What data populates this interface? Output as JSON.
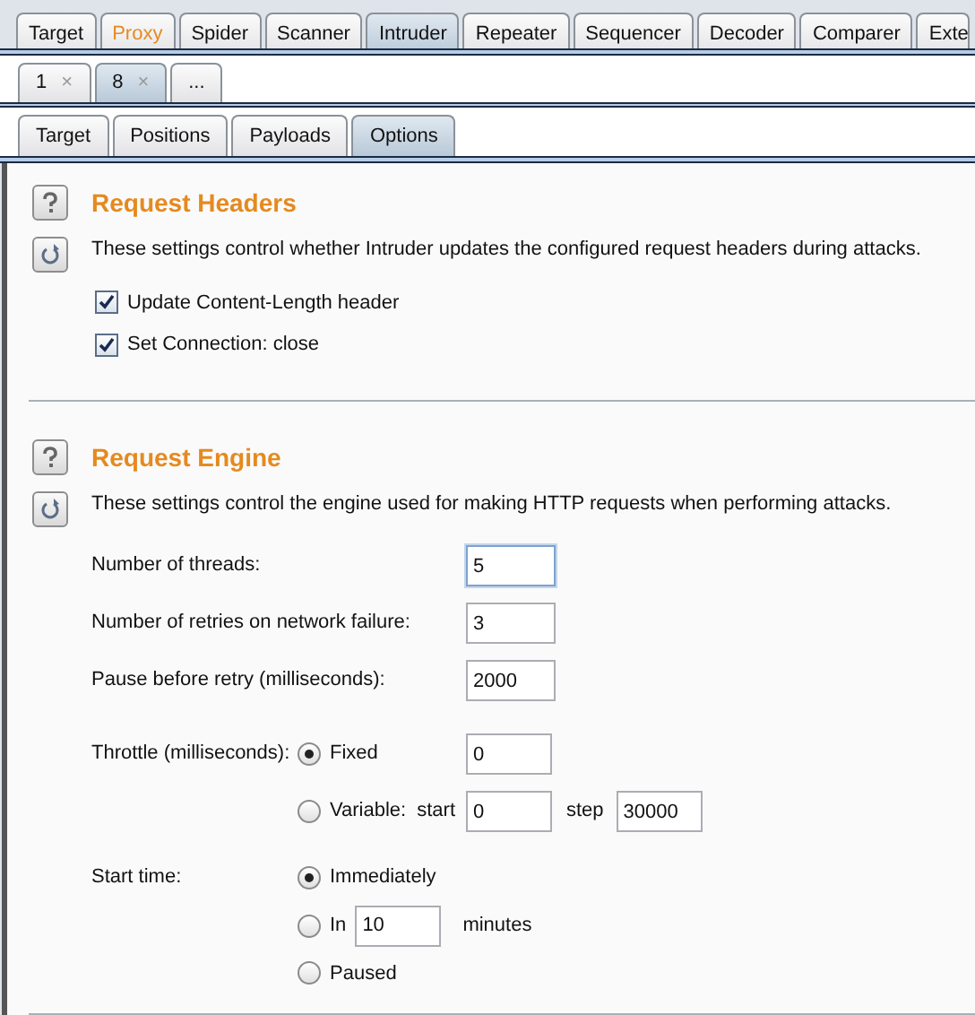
{
  "main_tabs": [
    {
      "label": "Target",
      "selected": false,
      "highlighted": false
    },
    {
      "label": "Proxy",
      "selected": false,
      "highlighted": true
    },
    {
      "label": "Spider",
      "selected": false,
      "highlighted": false
    },
    {
      "label": "Scanner",
      "selected": false,
      "highlighted": false
    },
    {
      "label": "Intruder",
      "selected": true,
      "highlighted": false
    },
    {
      "label": "Repeater",
      "selected": false,
      "highlighted": false
    },
    {
      "label": "Sequencer",
      "selected": false,
      "highlighted": false
    },
    {
      "label": "Decoder",
      "selected": false,
      "highlighted": false
    },
    {
      "label": "Comparer",
      "selected": false,
      "highlighted": false
    },
    {
      "label": "Exte",
      "selected": false,
      "highlighted": false
    }
  ],
  "attack_tabs": [
    {
      "label": "1",
      "close": "×",
      "selected": false
    },
    {
      "label": "8",
      "close": "×",
      "selected": true
    },
    {
      "label": "...",
      "selected": false
    }
  ],
  "sub_tabs": [
    {
      "label": "Target",
      "selected": false
    },
    {
      "label": "Positions",
      "selected": false
    },
    {
      "label": "Payloads",
      "selected": false
    },
    {
      "label": "Options",
      "selected": true
    }
  ],
  "request_headers": {
    "title": "Request Headers",
    "description": "These settings control whether Intruder updates the configured request headers during attacks.",
    "options": [
      {
        "label": "Update Content-Length header",
        "checked": true
      },
      {
        "label": "Set Connection: close",
        "checked": true
      }
    ]
  },
  "request_engine": {
    "title": "Request Engine",
    "description": "These settings control the engine used for making HTTP requests when performing attacks.",
    "fields": [
      {
        "label": "Number of threads:",
        "value": "5",
        "focused": true
      },
      {
        "label": "Number of retries on network failure:",
        "value": "3",
        "focused": false
      },
      {
        "label": "Pause before retry (milliseconds):",
        "value": "2000",
        "focused": false
      }
    ],
    "throttle": {
      "label": "Throttle (milliseconds):",
      "options": [
        {
          "kind": "fixed",
          "label": "Fixed",
          "selected": true,
          "value": "0"
        },
        {
          "kind": "range",
          "label": "Variable:",
          "selected": false,
          "start_label": "start",
          "start": "0",
          "step_label": "step",
          "step": "30000"
        }
      ]
    },
    "start_time": {
      "label": "Start time:",
      "options": [
        {
          "kind": "plain",
          "label": "Immediately",
          "selected": true
        },
        {
          "kind": "delay",
          "label": "In",
          "selected": false,
          "value": "10",
          "unit": "minutes"
        },
        {
          "kind": "plain",
          "label": "Paused",
          "selected": false
        }
      ]
    }
  }
}
